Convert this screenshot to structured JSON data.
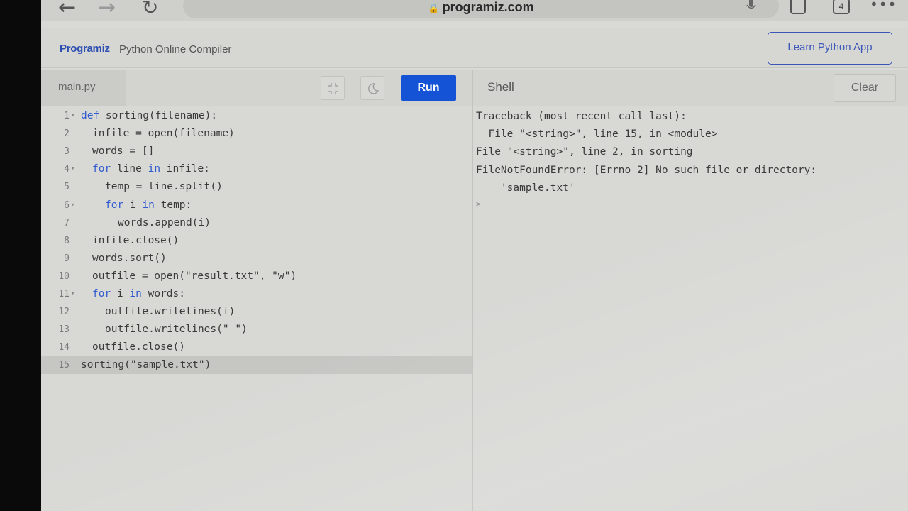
{
  "browser": {
    "url": "programiz.com",
    "tab_count": "4"
  },
  "header": {
    "logo": "Programiz",
    "title": "Python Online Compiler",
    "learn_button": "Learn Python App"
  },
  "editor": {
    "file_name": "main.py",
    "run_label": "Run",
    "lines": [
      {
        "n": "1",
        "fold": true,
        "indent": 0,
        "parts": [
          {
            "k": true,
            "t": "def"
          },
          {
            "t": " sorting(filename):"
          }
        ]
      },
      {
        "n": "2",
        "indent": 1,
        "parts": [
          {
            "t": "infile = open(filename)"
          }
        ]
      },
      {
        "n": "3",
        "indent": 1,
        "parts": [
          {
            "t": "words = []"
          }
        ]
      },
      {
        "n": "4",
        "fold": true,
        "indent": 1,
        "parts": [
          {
            "k": true,
            "t": "for"
          },
          {
            "t": " line "
          },
          {
            "k": true,
            "t": "in"
          },
          {
            "t": " infile:"
          }
        ]
      },
      {
        "n": "5",
        "indent": 2,
        "parts": [
          {
            "t": "temp = line.split()"
          }
        ]
      },
      {
        "n": "6",
        "fold": true,
        "indent": 2,
        "parts": [
          {
            "k": true,
            "t": "for"
          },
          {
            "t": " i "
          },
          {
            "k": true,
            "t": "in"
          },
          {
            "t": " temp:"
          }
        ]
      },
      {
        "n": "7",
        "indent": 3,
        "parts": [
          {
            "t": "words.append(i)"
          }
        ]
      },
      {
        "n": "8",
        "indent": 1,
        "parts": [
          {
            "t": "infile.close()"
          }
        ]
      },
      {
        "n": "9",
        "indent": 1,
        "parts": [
          {
            "t": "words.sort()"
          }
        ]
      },
      {
        "n": "10",
        "indent": 1,
        "parts": [
          {
            "t": "outfile = open(\"result.txt\", \"w\")"
          }
        ]
      },
      {
        "n": "11",
        "fold": true,
        "indent": 1,
        "parts": [
          {
            "k": true,
            "t": "for"
          },
          {
            "t": " i "
          },
          {
            "k": true,
            "t": "in"
          },
          {
            "t": " words:"
          }
        ]
      },
      {
        "n": "12",
        "indent": 2,
        "parts": [
          {
            "t": "outfile.writelines(i)"
          }
        ]
      },
      {
        "n": "13",
        "indent": 2,
        "parts": [
          {
            "t": "outfile.writelines(\" \")"
          }
        ]
      },
      {
        "n": "14",
        "indent": 1,
        "parts": [
          {
            "t": "outfile.close()"
          }
        ]
      },
      {
        "n": "15",
        "indent": 0,
        "active": true,
        "parts": [
          {
            "t": "sorting(\"sample.txt\")"
          }
        ]
      }
    ]
  },
  "shell": {
    "title": "Shell",
    "clear_label": "Clear",
    "output": [
      "Traceback (most recent call last):",
      "  File \"<string>\", line 15, in <module>",
      "File \"<string>\", line 2, in sorting",
      "FileNotFoundError: [Errno 2] No such file or directory:",
      "    'sample.txt'"
    ],
    "prompt": ">"
  }
}
